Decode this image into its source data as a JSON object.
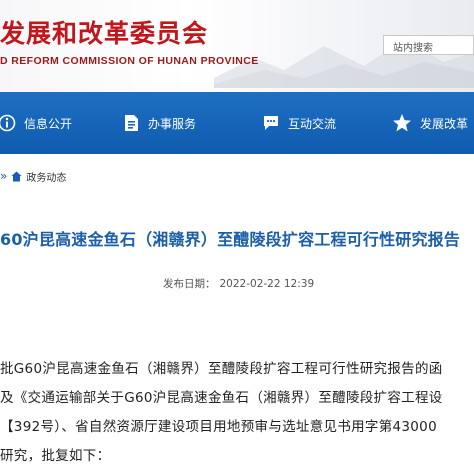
{
  "header": {
    "title": "发展和改革委员会",
    "subtitle": "D REFORM COMMISSION OF HUNAN PROVINCE",
    "search_label": "站内搜索"
  },
  "nav": {
    "items": [
      {
        "label": "信息公开",
        "icon": "info-icon"
      },
      {
        "label": "办事服务",
        "icon": "document-icon"
      },
      {
        "label": "互动交流",
        "icon": "chat-icon"
      },
      {
        "label": "发展改革",
        "icon": "star-icon"
      }
    ]
  },
  "breadcrumb": {
    "separator": "»",
    "item": "政务动态",
    "icon": "home-icon"
  },
  "article": {
    "title": "60沪昆高速金鱼石（湘赣界）至醴陵段扩容工程可行性研究报告",
    "meta_label": "发布日期：",
    "date": "2022-02-22 12:39",
    "lines": [
      "批G60沪昆高速金鱼石（湘赣界）至醴陵段扩容工程可行性研究报告的函",
      "及《交通运输部关于G60沪昆高速金鱼石（湘赣界）至醴陵段扩容工程设",
      "【392号）、省自然资源厅建设项目用地预审与选址意见书用字第43000",
      "研究，批复如下："
    ]
  },
  "colors": {
    "title_red": "#c0171d",
    "nav_blue": "#1565c0",
    "article_title_blue": "#1b5fa8"
  }
}
